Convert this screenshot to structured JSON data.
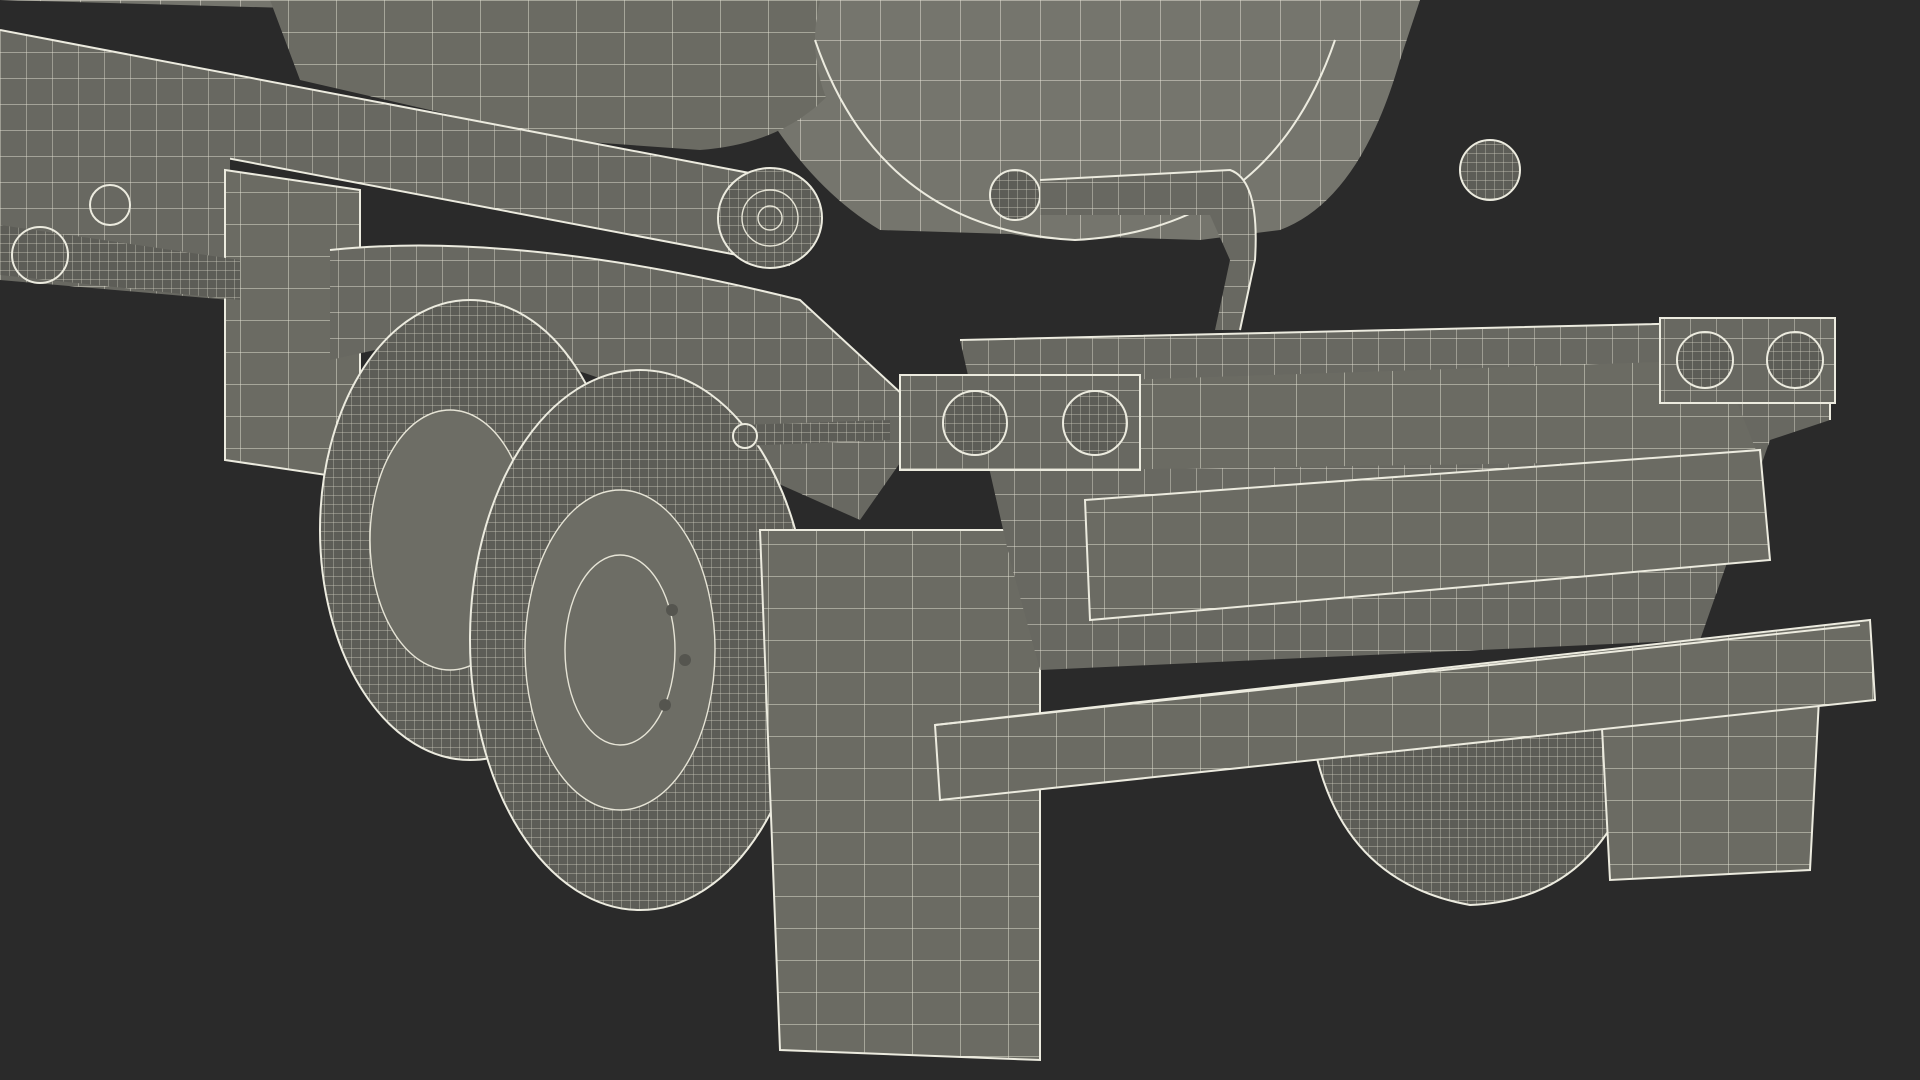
{
  "scene": {
    "background": "#2a2a2a",
    "model_color": "#6a6a62",
    "wireframe_color": "#e6e4d6"
  }
}
